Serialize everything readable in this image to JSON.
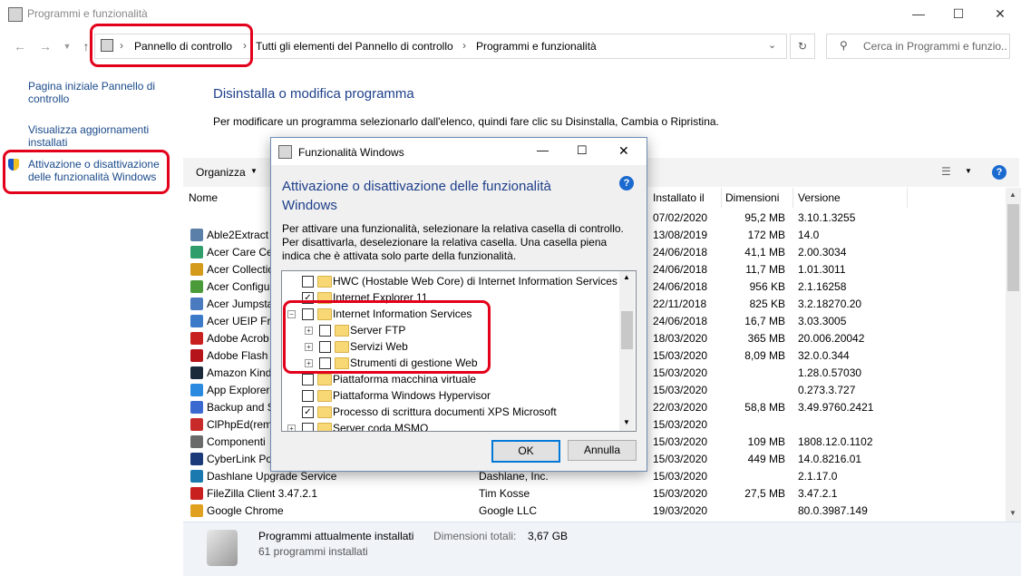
{
  "window": {
    "title": "Programmi e funzionalità"
  },
  "breadcrumb": {
    "items": [
      "Pannello di controllo",
      "Tutti gli elementi del Pannello di controllo",
      "Programmi e funzionalità"
    ]
  },
  "search": {
    "placeholder": "Cerca in Programmi e funzio..."
  },
  "sidebar": {
    "items": [
      "Pagina iniziale Pannello di controllo",
      "Visualizza aggiornamenti installati",
      "Attivazione o disattivazione delle funzionalità Windows"
    ]
  },
  "main": {
    "title": "Disinstalla o modifica programma",
    "description": "Per modificare un programma selezionarlo dall'elenco, quindi fare clic su Disinstalla, Cambia o Ripristina.",
    "organize_label": "Organizza",
    "columns": {
      "name": "Nome",
      "installed": "Installato il",
      "size": "Dimensioni",
      "version": "Versione"
    },
    "rows": [
      {
        "name": "",
        "publisher": "",
        "date": "07/02/2020",
        "size": "95,2 MB",
        "version": "3.10.1.3255",
        "color": "#ffffff"
      },
      {
        "name": "Able2Extract",
        "publisher": "",
        "date": "13/08/2019",
        "size": "172 MB",
        "version": "14.0",
        "color": "#5a7fa8"
      },
      {
        "name": "Acer Care Cen",
        "publisher": "",
        "date": "24/06/2018",
        "size": "41,1 MB",
        "version": "2.00.3034",
        "color": "#2f9e6b"
      },
      {
        "name": "Acer Collectio",
        "publisher": "",
        "date": "24/06/2018",
        "size": "11,7 MB",
        "version": "1.01.3011",
        "color": "#d49a1a"
      },
      {
        "name": "Acer Configu",
        "publisher": "",
        "date": "24/06/2018",
        "size": "956 KB",
        "version": "2.1.16258",
        "color": "#4a9a3a"
      },
      {
        "name": "Acer Jumpsta",
        "publisher": "",
        "date": "22/11/2018",
        "size": "825 KB",
        "version": "3.2.18270.20",
        "color": "#4a7abf"
      },
      {
        "name": "Acer UEIP Fra",
        "publisher": "",
        "date": "24/06/2018",
        "size": "16,7 MB",
        "version": "3.03.3005",
        "color": "#3a7ac8"
      },
      {
        "name": "Adobe Acrob",
        "publisher": "",
        "date": "18/03/2020",
        "size": "365 MB",
        "version": "20.006.20042",
        "color": "#c8201e"
      },
      {
        "name": "Adobe Flash P",
        "publisher": "",
        "date": "15/03/2020",
        "size": "8,09 MB",
        "version": "32.0.0.344",
        "color": "#b5141a"
      },
      {
        "name": "Amazon Kind",
        "publisher": "",
        "date": "15/03/2020",
        "size": "",
        "version": "1.28.0.57030",
        "color": "#1a2a3a"
      },
      {
        "name": "App Explorer",
        "publisher": "",
        "date": "15/03/2020",
        "size": "",
        "version": "0.273.3.727",
        "color": "#2a8ae0"
      },
      {
        "name": "Backup and S",
        "publisher": "",
        "date": "22/03/2020",
        "size": "58,8 MB",
        "version": "3.49.9760.2421",
        "color": "#3a6ad0"
      },
      {
        "name": "ClPhpEd(rem",
        "publisher": "",
        "date": "15/03/2020",
        "size": "",
        "version": "",
        "color": "#c82a2a"
      },
      {
        "name": "Componenti",
        "publisher": "",
        "date": "15/03/2020",
        "size": "109 MB",
        "version": "1808.12.0.1102",
        "color": "#6a6a6a"
      },
      {
        "name": "CyberLink Po",
        "publisher": "",
        "date": "15/03/2020",
        "size": "449 MB",
        "version": "14.0.8216.01",
        "color": "#1a3a7a"
      },
      {
        "name": "Dashlane Upgrade Service",
        "publisher": "Dashlane, Inc.",
        "date": "15/03/2020",
        "size": "",
        "version": "2.1.17.0",
        "color": "#1a7ab0"
      },
      {
        "name": "FileZilla Client 3.47.2.1",
        "publisher": "Tim Kosse",
        "date": "15/03/2020",
        "size": "27,5 MB",
        "version": "3.47.2.1",
        "color": "#c8201e"
      },
      {
        "name": "Google Chrome",
        "publisher": "Google LLC",
        "date": "19/03/2020",
        "size": "",
        "version": "80.0.3987.149",
        "color": "#e0a020"
      }
    ]
  },
  "status": {
    "title": "Programmi attualmente installati",
    "size_label": "Dimensioni totali:",
    "size_value": "3,67 GB",
    "count": "61 programmi installati"
  },
  "dialog": {
    "title": "Funzionalità Windows",
    "heading": "Attivazione o disattivazione delle funzionalità Windows",
    "description": "Per attivare una funzionalità, selezionare la relativa casella di controllo. Per disattivarla, deselezionare la relativa casella. Una casella piena indica che è attivata solo parte della funzionalità.",
    "features": [
      {
        "label": "HWC (Hostable Web Core) di Internet Information Services",
        "level": 0,
        "checked": false,
        "expandable": false
      },
      {
        "label": "Internet Explorer 11",
        "level": 0,
        "checked": true,
        "expandable": false
      },
      {
        "label": "Internet Information Services",
        "level": 0,
        "checked": false,
        "expandable": true,
        "expanded": true
      },
      {
        "label": "Server FTP",
        "level": 1,
        "checked": false,
        "expandable": true
      },
      {
        "label": "Servizi Web",
        "level": 1,
        "checked": false,
        "expandable": true
      },
      {
        "label": "Strumenti di gestione Web",
        "level": 1,
        "checked": false,
        "expandable": true
      },
      {
        "label": "Piattaforma macchina virtuale",
        "level": 0,
        "checked": false,
        "expandable": false
      },
      {
        "label": "Piattaforma Windows Hypervisor",
        "level": 0,
        "checked": false,
        "expandable": false
      },
      {
        "label": "Processo di scrittura documenti XPS Microsoft",
        "level": 0,
        "checked": true,
        "expandable": false
      },
      {
        "label": "Server coda MSMQ",
        "level": 0,
        "checked": false,
        "expandable": true
      }
    ],
    "ok_label": "OK",
    "cancel_label": "Annulla"
  },
  "colors": {
    "highlight": "#e3001b",
    "link": "#1a4a8a",
    "heading": "#1e3f8a"
  }
}
